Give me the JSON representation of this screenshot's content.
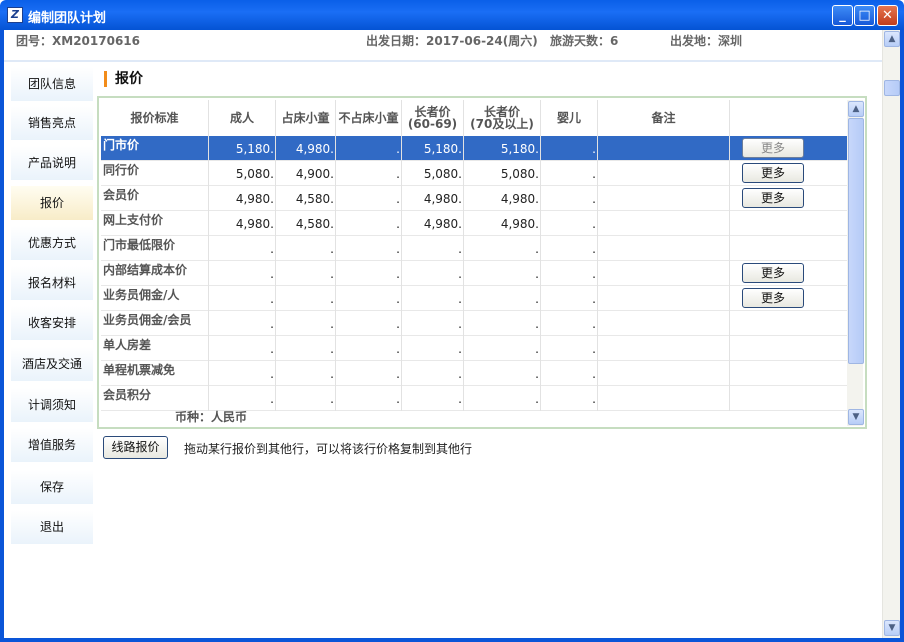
{
  "window": {
    "title": "编制团队计划",
    "minimize": "_",
    "maximize": "□",
    "close": "✕"
  },
  "info": {
    "group_no": "团号：XM20170616",
    "departure_date": "出发日期：2017-06-24(周六)",
    "days": "旅游天数：6",
    "departure_place": "出发地：深圳"
  },
  "sidebar": {
    "items": [
      {
        "label": "团队信息"
      },
      {
        "label": "销售亮点"
      },
      {
        "label": "产品说明"
      },
      {
        "label": "报价",
        "active": true
      },
      {
        "label": "优惠方式"
      },
      {
        "label": "报名材料"
      },
      {
        "label": "收客安排"
      },
      {
        "label": "酒店及交通"
      },
      {
        "label": "计调须知"
      },
      {
        "label": "增值服务"
      },
      {
        "label": "保存"
      },
      {
        "label": "退出"
      }
    ]
  },
  "section_title": "报价",
  "table": {
    "headers": [
      {
        "label": "报价标准"
      },
      {
        "label": "成人"
      },
      {
        "label": "占床小童"
      },
      {
        "label": "不占床小童"
      },
      {
        "label": "长者价",
        "sub": "(60-69)"
      },
      {
        "label": "长者价",
        "sub": "(70及以上)"
      },
      {
        "label": "婴儿"
      },
      {
        "label": "备注"
      }
    ],
    "rows": [
      {
        "label": "门市价",
        "adult": "5,180.",
        "child_bed": "4,980.",
        "child_nobed": ".",
        "senior60": "5,180.",
        "senior70": "5,180.",
        "infant": ".",
        "more": "更多",
        "selected": true
      },
      {
        "label": "同行价",
        "adult": "5,080.",
        "child_bed": "4,900.",
        "child_nobed": ".",
        "senior60": "5,080.",
        "senior70": "5,080.",
        "infant": ".",
        "more": "更多"
      },
      {
        "label": "会员价",
        "adult": "4,980.",
        "child_bed": "4,580.",
        "child_nobed": ".",
        "senior60": "4,980.",
        "senior70": "4,980.",
        "infant": ".",
        "more": "更多"
      },
      {
        "label": "网上支付价",
        "adult": "4,980.",
        "child_bed": "4,580.",
        "child_nobed": ".",
        "senior60": "4,980.",
        "senior70": "4,980.",
        "infant": "."
      },
      {
        "label": "门市最低限价",
        "adult": ".",
        "child_bed": ".",
        "child_nobed": ".",
        "senior60": ".",
        "senior70": ".",
        "infant": "."
      },
      {
        "label": "内部结算成本价",
        "adult": ".",
        "child_bed": ".",
        "child_nobed": ".",
        "senior60": ".",
        "senior70": ".",
        "infant": ".",
        "more": "更多"
      },
      {
        "label": "业务员佣金/人",
        "adult": ".",
        "child_bed": ".",
        "child_nobed": ".",
        "senior60": ".",
        "senior70": ".",
        "infant": ".",
        "more": "更多"
      },
      {
        "label": "业务员佣金/会员",
        "adult": ".",
        "child_bed": ".",
        "child_nobed": ".",
        "senior60": ".",
        "senior70": ".",
        "infant": "."
      },
      {
        "label": "单人房差",
        "adult": ".",
        "child_bed": ".",
        "child_nobed": ".",
        "senior60": ".",
        "senior70": ".",
        "infant": "."
      },
      {
        "label": "单程机票减免",
        "adult": ".",
        "child_bed": ".",
        "child_nobed": ".",
        "senior60": ".",
        "senior70": ".",
        "infant": "."
      },
      {
        "label": "会员积分",
        "adult": ".",
        "child_bed": ".",
        "child_nobed": ".",
        "senior60": ".",
        "senior70": ".",
        "infant": "."
      }
    ],
    "currency": "币种：人民币"
  },
  "route_button": "线路报价",
  "hint": "拖动某行报价到其他行，可以将该行价格复制到其他行",
  "colors": {
    "titlebar": "#0a5fe8",
    "selected_row": "#316ac5",
    "accent": "#f28c1a"
  },
  "icons": {
    "scroll_up": "▲",
    "scroll_down": "▼"
  }
}
